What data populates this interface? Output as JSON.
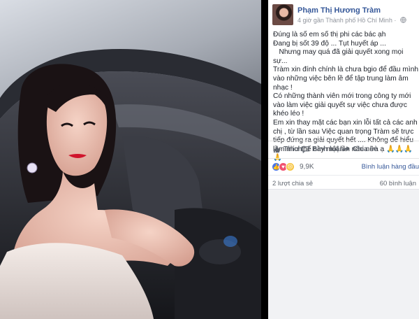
{
  "post": {
    "author": "Phạm Thị Hương Tràm",
    "meta": "4 giờ gần Thành phố Hồ Chí Minh ·",
    "text": "Đúng là số em số thị phi các bác ạh\nĐang bị sốt 39 độ ... Tụt huyết áp ...\n   Nhưng may quá đã giải quyết xong mọi sự...\nTràm xin đính chính là chưa bgio để đầu mình vào những việc bên lề để tập trung làm âm nhạc !\nCó những thành viên mới trong công ty mới vào làm việc giải quyết sự việc chưa được khéo léo !\nEm xin thay mặt các bạn xin lỗi tất cả các anh chị , từ lần sau Việc quan trọng Tràm sẽ trực tiếp đứng ra giải quyết hết .... Không để hiểu lầm như thế này một lần nào nữa ạ 🙏🙏🙏🙏"
  },
  "actions": {
    "like": "Thích",
    "comment": "Bình luận",
    "share": "Chia sẻ"
  },
  "reactions": {
    "count": "9,9K",
    "sort_label": "Bình luận hàng đầu"
  },
  "stats": {
    "shares": "2 lượt chia sẻ",
    "comments": "60 bình luận"
  },
  "colors": {
    "link_blue": "#365899",
    "text_dark": "#1d2129",
    "text_gray": "#616770"
  }
}
